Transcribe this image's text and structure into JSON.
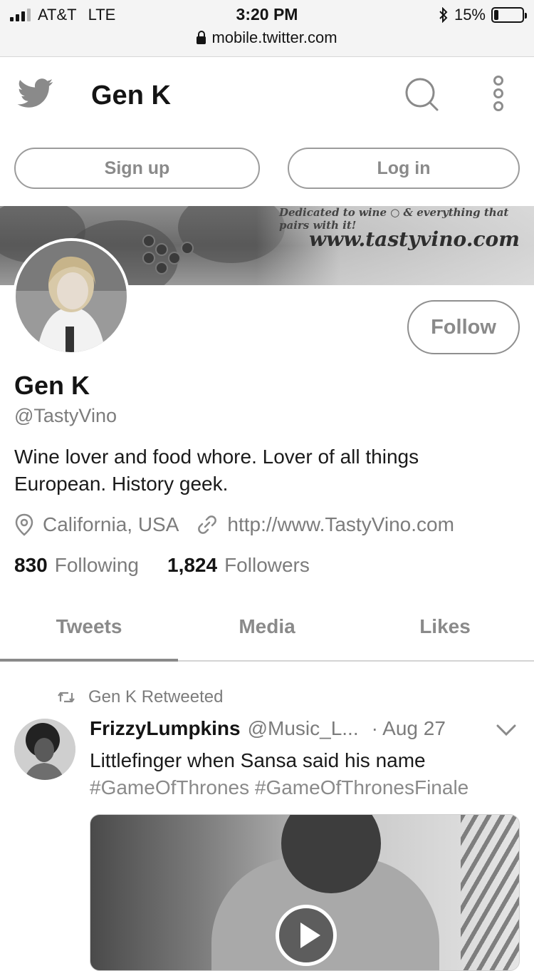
{
  "status_bar": {
    "carrier": "AT&T",
    "network": "LTE",
    "time": "3:20 PM",
    "battery": "15%",
    "battery_level": 0.15,
    "signal_bars_active": 3,
    "signal_bars_total": 4,
    "url": "mobile.twitter.com"
  },
  "header": {
    "title": "Gen K",
    "signup_label": "Sign up",
    "login_label": "Log in"
  },
  "banner": {
    "tagline": "Dedicated to wine ○ & everything that pairs with it!",
    "url_text": "www.tastyvino.com"
  },
  "profile": {
    "name": "Gen K",
    "handle": "@TastyVino",
    "follow_label": "Follow",
    "bio": "Wine lover and food whore. Lover of all things European. History geek.",
    "location": "California, USA",
    "website": "http://www.TastyVino.com",
    "following_count": "830",
    "following_label": "Following",
    "followers_count": "1,824",
    "followers_label": "Followers"
  },
  "tabs": [
    {
      "label": "Tweets",
      "active": true
    },
    {
      "label": "Media",
      "active": false
    },
    {
      "label": "Likes",
      "active": false
    }
  ],
  "tweet": {
    "retweet_text": "Gen K Retweeted",
    "author_name": "FrizzyLumpkins",
    "author_handle": "@Music_L...",
    "date": "· Aug 27",
    "text": "Littlefinger when Sansa said his name",
    "hashtags": "#GameOfThrones #GameOfThronesFinale"
  },
  "colors": {
    "text_primary": "#141414",
    "text_secondary": "#7c7c7c",
    "border": "#9c9c9c"
  }
}
